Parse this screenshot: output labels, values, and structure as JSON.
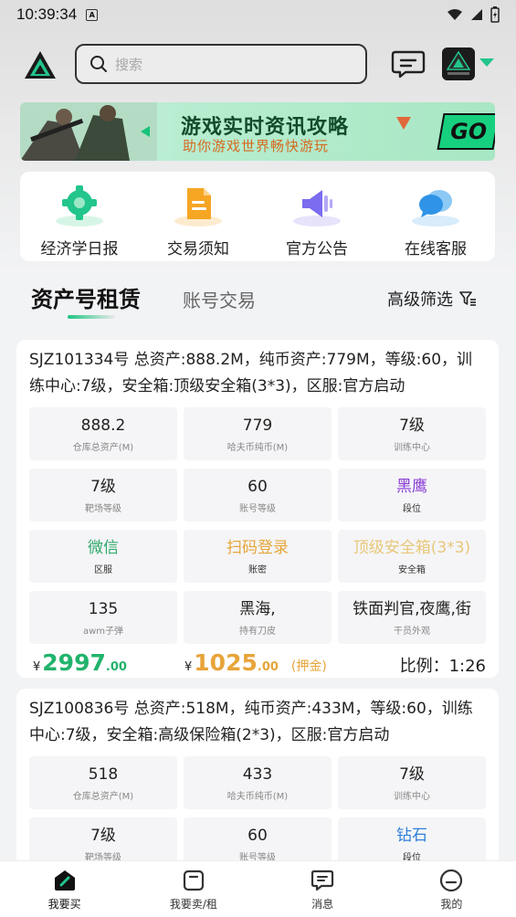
{
  "status_bar": {
    "time": "10:39:34",
    "notif_icon": "a-icon"
  },
  "header": {
    "search_placeholder": "搜索",
    "accent": "#22c58b"
  },
  "banner": {
    "title": "游戏实时资讯攻略",
    "subtitle": "助你游戏世界畅快游玩",
    "go_label": "GO"
  },
  "quick_links": [
    {
      "label": "经济学日报",
      "icon": "gear-icon"
    },
    {
      "label": "交易须知",
      "icon": "document-icon"
    },
    {
      "label": "官方公告",
      "icon": "megaphone-icon"
    },
    {
      "label": "在线客服",
      "icon": "chat-bubble-icon"
    }
  ],
  "tabs": {
    "active": "资产号租赁",
    "inactive": "账号交易",
    "filter_label": "高级筛选"
  },
  "listings": [
    {
      "desc": "SJZ101334号 总资产:888.2M，纯币资产:779M，等级:60，训练中心:7级，安全箱:顶级安全箱(3*3)，区服:官方启动",
      "cells": [
        {
          "v": "888.2",
          "k": "仓库总资产(M)",
          "color": "#222222"
        },
        {
          "v": "779",
          "k": "哈夫币纯币(M)",
          "color": "#222222"
        },
        {
          "v": "7级",
          "k": "训练中心",
          "color": "#222222"
        },
        {
          "v": "7级",
          "k": "靶场等级",
          "color": "#222222"
        },
        {
          "v": "60",
          "k": "账号等级",
          "color": "#222222"
        },
        {
          "v": "黑鹰",
          "k": "段位",
          "color": "#8a3ed6"
        },
        {
          "v": "微信",
          "k": "区服",
          "color": "#2ea86a"
        },
        {
          "v": "扫码登录",
          "k": "账密",
          "color": "#e6a63a"
        },
        {
          "v": "顶级安全箱(3*3)",
          "k": "安全箱",
          "color": "#e8c77a"
        },
        {
          "v": "135",
          "k": "awm子弹",
          "color": "#222222"
        },
        {
          "v": "黑海,",
          "k": "持有刀皮",
          "color": "#222222"
        },
        {
          "v": "铁面判官,夜鹰,街",
          "k": "干员外观",
          "color": "#222222"
        }
      ],
      "price_currency": "¥",
      "rent_int": "2997",
      "rent_dec": ".00",
      "deposit_int": "1025",
      "deposit_dec": ".00",
      "deposit_label": "(押金)",
      "ratio": "比例：1:26"
    },
    {
      "desc": "SJZ100836号 总资产:518M，纯币资产:433M，等级:60，训练中心:7级，安全箱:高级保险箱(2*3)，区服:官方启动",
      "cells": [
        {
          "v": "518",
          "k": "仓库总资产(M)",
          "color": "#222222"
        },
        {
          "v": "433",
          "k": "哈夫币纯币(M)",
          "color": "#222222"
        },
        {
          "v": "7级",
          "k": "训练中心",
          "color": "#222222"
        },
        {
          "v": "7级",
          "k": "靶场等级",
          "color": "#222222"
        },
        {
          "v": "60",
          "k": "账号等级",
          "color": "#222222"
        },
        {
          "v": "钻石",
          "k": "段位",
          "color": "#2f7fd8"
        }
      ]
    }
  ],
  "bottom_nav": [
    {
      "label": "我要买",
      "icon": "home-icon",
      "active": true
    },
    {
      "label": "我要卖/租",
      "icon": "bag-icon",
      "active": false
    },
    {
      "label": "消息",
      "icon": "message-icon",
      "active": false
    },
    {
      "label": "我的",
      "icon": "profile-icon",
      "active": false
    }
  ]
}
